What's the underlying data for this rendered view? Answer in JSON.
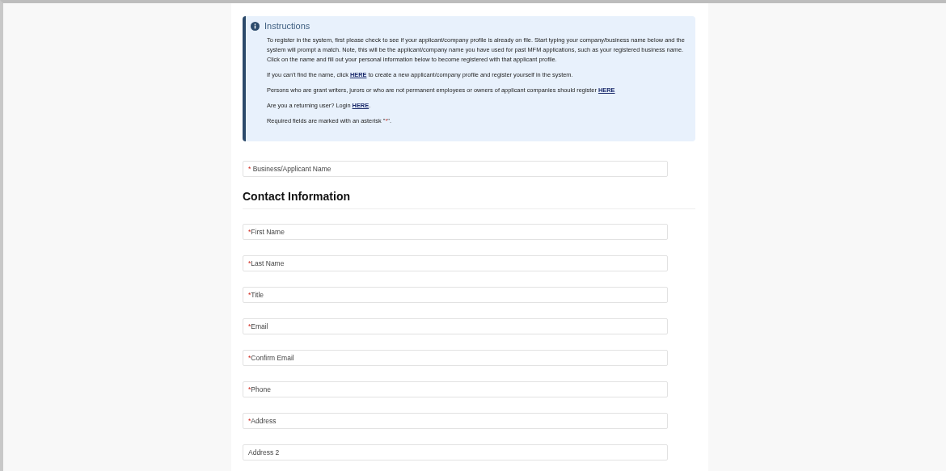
{
  "instructions": {
    "title": "Instructions",
    "paragraphs": [
      [
        {
          "kind": "text",
          "text": "To register in the system, first please check to see if your applicant/company profile is already on file. Start typing your company/business name below and the system will prompt a match. Note, this will be the applicant/company name you have used for past MFM applications, such as your registered business name. Click on the name and fill out your personal information below to become registered with that applicant profile."
        }
      ],
      [
        {
          "kind": "text",
          "text": "If you can't find the name, click "
        },
        {
          "kind": "link",
          "text": "HERE"
        },
        {
          "kind": "text",
          "text": " to create a new applicant/company profile and register yourself in the system."
        }
      ],
      [
        {
          "kind": "text",
          "text": "Persons who are grant writers, jurors or who are not permanent employees or owners of applicant companies should register "
        },
        {
          "kind": "link",
          "text": "HERE"
        }
      ],
      [
        {
          "kind": "text",
          "text": "Are you a returning user? Login "
        },
        {
          "kind": "link",
          "text": "HERE"
        },
        {
          "kind": "text",
          "text": "."
        }
      ],
      [
        {
          "kind": "text",
          "text": "Required fields are marked with an asterisk \""
        },
        {
          "kind": "mark",
          "text": "*"
        },
        {
          "kind": "text",
          "text": "\"."
        }
      ]
    ]
  },
  "business_field": {
    "mark": "*",
    "placeholder": "Business/Applicant Name"
  },
  "section_title": "Contact Information",
  "fields": [
    {
      "mark": "*",
      "placeholder": "First Name"
    },
    {
      "mark": "*",
      "placeholder": "Last Name"
    },
    {
      "mark": "*",
      "placeholder": "Title"
    },
    {
      "mark": "*",
      "placeholder": "Email"
    },
    {
      "mark": "*",
      "placeholder": "Confirm Email"
    },
    {
      "mark": "*",
      "placeholder": "Phone"
    },
    {
      "mark": "*",
      "placeholder": "Address"
    },
    {
      "placeholder": "Address 2"
    }
  ]
}
